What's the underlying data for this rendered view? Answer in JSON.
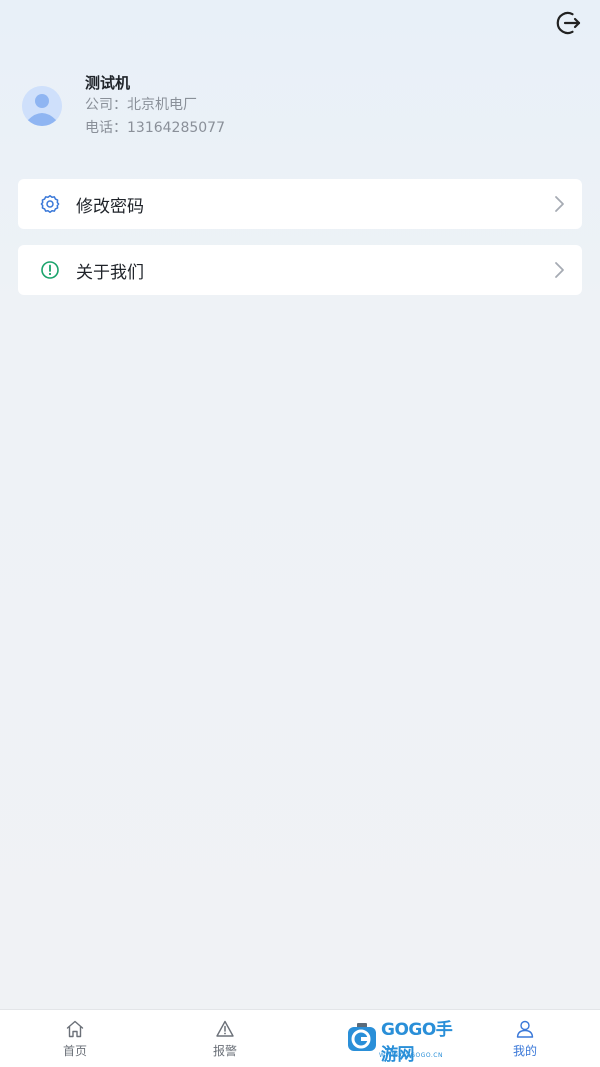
{
  "header": {
    "logout_icon": "logout-icon"
  },
  "profile": {
    "name": "测试机",
    "company": "公司：北京机电厂",
    "phone": "电话：13164285077"
  },
  "menu": [
    {
      "label": "修改密码",
      "icon": "gear-icon",
      "accent": "#3a78d8"
    },
    {
      "label": "关于我们",
      "icon": "info-circle-icon",
      "accent": "#1aa36b"
    }
  ],
  "tabbar": {
    "items": [
      {
        "label": "首页",
        "icon": "home-icon",
        "active": false
      },
      {
        "label": "报警",
        "icon": "warning-icon",
        "active": false
      },
      {
        "label": "",
        "icon": "",
        "active": false
      },
      {
        "label": "我的",
        "icon": "user-icon",
        "active": true
      }
    ]
  },
  "watermark": {
    "text": "GOGO手游网",
    "url": "WWW.GOGOGO.CN"
  },
  "colors": {
    "accent": "#3a78d8",
    "green": "#1aa36b",
    "text": "#1f2329",
    "muted": "#8a9099"
  }
}
